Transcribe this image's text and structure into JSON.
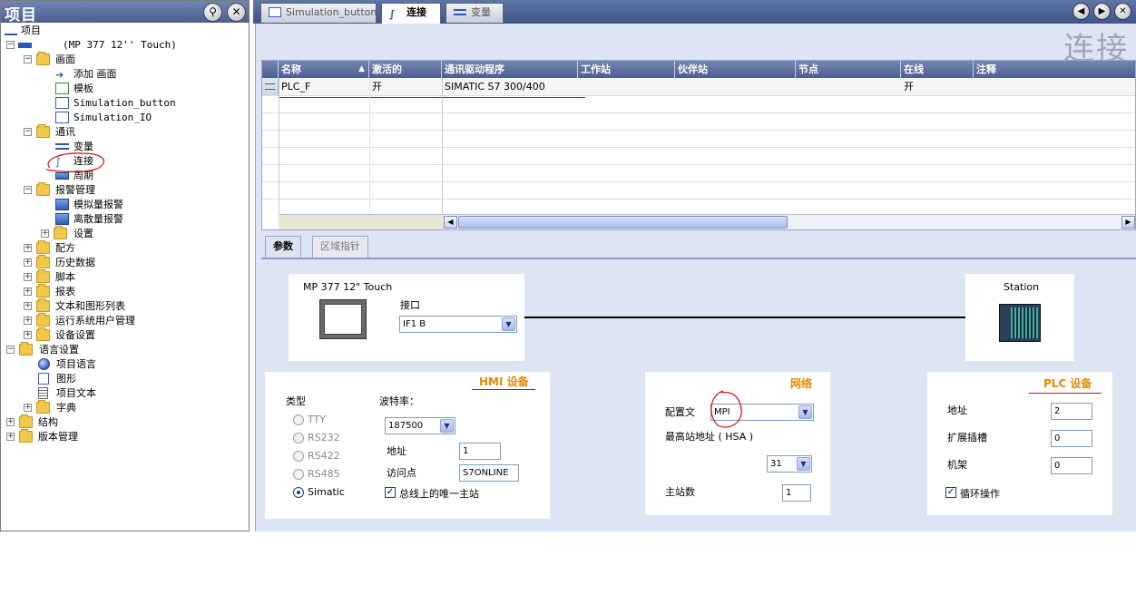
{
  "left_panel": {
    "title": "项目",
    "pin_label": "⚲",
    "close_label": "✕",
    "tree": {
      "root": "项目",
      "device": "(MP 377 12'' Touch)",
      "screens": "画面",
      "add_screen": "添加 画面",
      "template": "模板",
      "screen1": "Simulation_button",
      "screen2": "Simulation_IO",
      "comm": "通讯",
      "tags": "变量",
      "connections": "连接",
      "cycles": "周期",
      "alarm_mgmt": "报警管理",
      "analog_alarms": "模拟量报警",
      "discrete_alarms": "离散量报警",
      "alarm_settings": "设置",
      "recipes": "配方",
      "historical": "历史数据",
      "scripts": "脚本",
      "reports": "报表",
      "text_graphic_lists": "文本和图形列表",
      "runtime_user_admin": "运行系统用户管理",
      "device_settings": "设备设置",
      "lang_settings": "语言设置",
      "project_languages": "项目语言",
      "graphics": "图形",
      "project_texts": "项目文本",
      "dictionary": "字典",
      "structure": "结构",
      "version_mgmt": "版本管理"
    }
  },
  "tabs": [
    {
      "label": "Simulation_button"
    },
    {
      "label": "连接"
    },
    {
      "label": "变量"
    }
  ],
  "editor_title": "连接",
  "grid": {
    "headers": [
      "名称",
      "激活的",
      "通讯驱动程序",
      "工作站",
      "伙伴站",
      "节点",
      "在线",
      "注释"
    ],
    "rows": [
      {
        "name": "PLC_F",
        "active": "开",
        "driver": "SIMATIC S7 300/400",
        "station": "",
        "partner": "",
        "node": "",
        "online": "开",
        "comment": ""
      }
    ]
  },
  "subtabs": {
    "params": "参数",
    "area_pointer": "区域指针"
  },
  "hmi_device": {
    "name": "MP 377 12\" Touch",
    "interface_label": "接口",
    "interface_value": "IF1 B"
  },
  "station": {
    "name": "Station"
  },
  "hmi_panel": {
    "title": "HMI 设备",
    "type_label": "类型",
    "types": [
      "TTY",
      "RS232",
      "RS422",
      "RS485",
      "Simatic"
    ],
    "selected_type": "Simatic",
    "baud_label": "波特率：",
    "baud_value": "187500",
    "address_label": "地址",
    "address_value": "1",
    "access_point_label": "访问点",
    "access_point_value": "S7ONLINE",
    "only_master_label": "总线上的唯一主站",
    "only_master_checked": true
  },
  "network_panel": {
    "title": "网络",
    "profile_label": "配置文",
    "profile_value": "MPI",
    "hsa_label": "最高站地址 ( HSA )",
    "hsa_value": "31",
    "masters_label": "主站数",
    "masters_value": "1"
  },
  "plc_panel": {
    "title": "PLC 设备",
    "address_label": "地址",
    "address_value": "2",
    "slot_label": "扩展插槽",
    "slot_value": "0",
    "rack_label": "机架",
    "rack_value": "0",
    "cyclic_label": "循环操作",
    "cyclic_checked": true
  },
  "colors": {
    "accent": "#4c5e8d",
    "section_title": "#e58a00",
    "annotation_red": "#d01010"
  }
}
